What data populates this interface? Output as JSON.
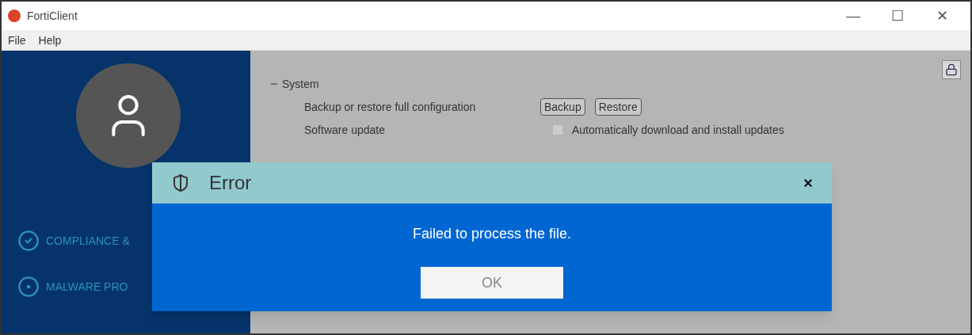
{
  "window": {
    "title": "FortiClient",
    "controls": [
      "—",
      "☐",
      "✕"
    ]
  },
  "menu": [
    "File",
    "Help"
  ],
  "sidebar": {
    "items": [
      {
        "label": "COMPLIANCE &",
        "kind": "check"
      },
      {
        "label": "MALWARE PRO",
        "kind": "dot"
      }
    ]
  },
  "settings": {
    "section": {
      "title": "System",
      "expanded": true
    },
    "rows": [
      {
        "label": "Backup or restore full configuration",
        "buttons": [
          "Backup",
          "Restore"
        ]
      },
      {
        "label": "Software update",
        "option": "Automatically download and install updates",
        "checked": false
      }
    ]
  },
  "dialog": {
    "title": "Error",
    "close": "×",
    "message": "Failed to process the file.",
    "button": "OK"
  }
}
